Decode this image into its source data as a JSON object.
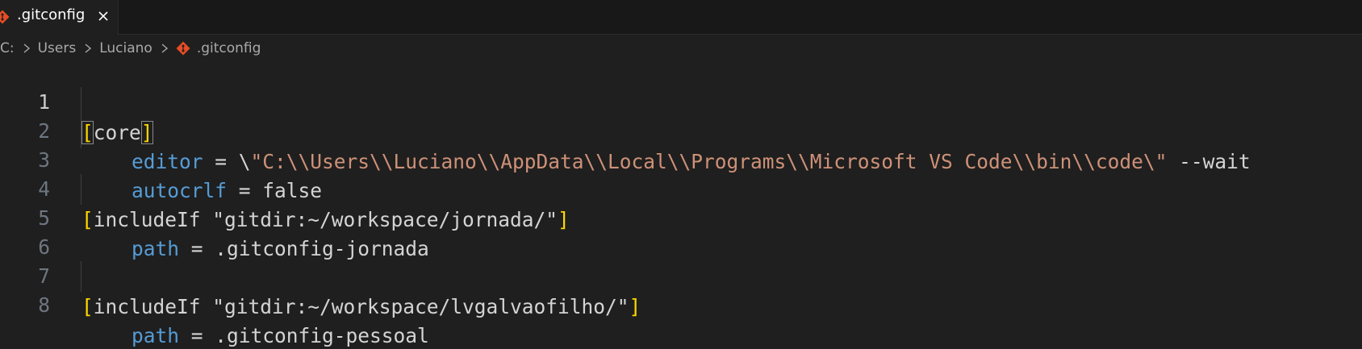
{
  "tab": {
    "label": ".gitconfig",
    "close_glyph": "✕",
    "icon": "git-file-icon"
  },
  "breadcrumb": {
    "items": [
      "C:",
      "Users",
      "Luciano",
      ".gitconfig"
    ],
    "separator_icon": "chevron-right-icon"
  },
  "editor": {
    "lines": [
      {
        "num": "1",
        "open": "[",
        "section": "core",
        "close": "]"
      },
      {
        "num": "2",
        "key": "editor",
        "eq": " = ",
        "pre": "\\",
        "str": "\"C:\\\\Users\\\\Luciano\\\\AppData\\\\Local\\\\Programs\\\\Microsoft VS Code\\\\bin\\\\code\\\"",
        "post": " --wait"
      },
      {
        "num": "3",
        "key": "autocrlf",
        "eq": " = ",
        "value": "false"
      },
      {
        "num": "4",
        "open": "[",
        "section": "includeIf \"gitdir:~/workspace/jornada/\"",
        "close": "]"
      },
      {
        "num": "5",
        "key": "path",
        "eq": " = ",
        "value": ".gitconfig-jornada"
      },
      {
        "num": "6"
      },
      {
        "num": "7",
        "open": "[",
        "section": "includeIf \"gitdir:~/workspace/lvgalvaofilho/\"",
        "close": "]"
      },
      {
        "num": "8",
        "key": "path",
        "eq": " = ",
        "value": ".gitconfig-pessoal"
      }
    ]
  },
  "colors": {
    "background": "#1f1f1f",
    "keyword": "#569cd6",
    "string": "#ce9178",
    "bracket": "#ffd700",
    "text": "#d4d4d4",
    "line_number": "#6e7681",
    "git_icon": "#e44d26"
  }
}
